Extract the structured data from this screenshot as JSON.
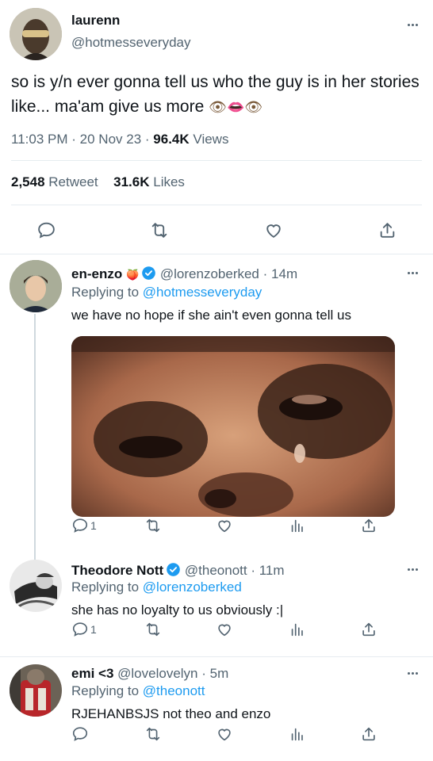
{
  "main_tweet": {
    "display_name": "laurenn",
    "handle": "@hotmesseveryday",
    "text": "so is y/n ever gonna tell us who the guy is in her stories like... ma'am give us more",
    "emojis": "👁👄👁",
    "time": "11:03 PM",
    "date": "20 Nov 23",
    "views_count": "96.4K",
    "views_label": "Views",
    "retweets_count": "2,548",
    "retweets_label": "Retweet",
    "likes_count": "31.6K",
    "likes_label": "Likes",
    "separator": "·"
  },
  "replies": [
    {
      "display_name": "en-enzo",
      "badge_emoji": "🍑",
      "verified": true,
      "handle": "@lorenzoberked",
      "time_ago": "14m",
      "replying_label": "Replying to",
      "replying_to": "@hotmesseveryday",
      "text": "we have no hope if she ain't even gonna tell us",
      "has_media": true,
      "reply_count": "1"
    },
    {
      "display_name": "Theodore Nott",
      "verified": true,
      "handle": "@theonott",
      "time_ago": "11m",
      "replying_label": "Replying to",
      "replying_to": "@lorenzoberked",
      "text": "she has no loyalty to us obviously :|",
      "reply_count": "1"
    },
    {
      "display_name": "emi <3",
      "verified": false,
      "handle": "@lovelovelyn",
      "time_ago": "5m",
      "replying_label": "Replying to",
      "replying_to": "@theonott",
      "text": "RJEHANBSJS not theo and enzo",
      "reply_count": ""
    }
  ],
  "colors": {
    "accent": "#1d9bf0",
    "text_primary": "#0f1419",
    "text_secondary": "#536471",
    "divider": "#e6ecf0",
    "thread_line": "#cfd9de"
  },
  "icons": [
    "reply-icon",
    "retweet-icon",
    "like-icon",
    "share-icon",
    "views-icon",
    "more-icon",
    "verified-icon"
  ]
}
